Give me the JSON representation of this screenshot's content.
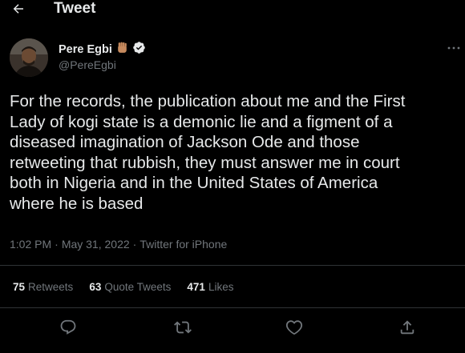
{
  "header": {
    "title": "Tweet",
    "back_icon": "arrow-left-icon"
  },
  "author": {
    "display_name": "Pere Egbi",
    "handle": "@PereEgbi",
    "emoji_icon": "raised-fist-icon",
    "verified_icon": "verified-badge-icon",
    "more_icon": "more-horizontal-icon"
  },
  "tweet": {
    "text": "For the records, the publication about me and the First\nLady of kogi state is a demonic lie and a figment of a\ndiseased imagination of Jackson Ode and those\nretweeting that rubbish, they must answer me in court\nboth in Nigeria and in the United States of America\nwhere he is based"
  },
  "meta": {
    "time": "1:02 PM",
    "separator1": "·",
    "date": "May 31, 2022",
    "separator2": "·",
    "source": "Twitter for iPhone"
  },
  "stats": {
    "retweets_count": "75",
    "retweets_label": "Retweets",
    "quotes_count": "63",
    "quotes_label": "Quote Tweets",
    "likes_count": "471",
    "likes_label": "Likes"
  },
  "actions": [
    "reply-icon",
    "retweet-icon",
    "like-icon",
    "share-icon"
  ],
  "colors": {
    "background": "#000000",
    "text_primary": "#e7e9ea",
    "text_secondary": "#71767b",
    "divider": "#2f3336",
    "emoji_skin": "#c68a5e"
  }
}
